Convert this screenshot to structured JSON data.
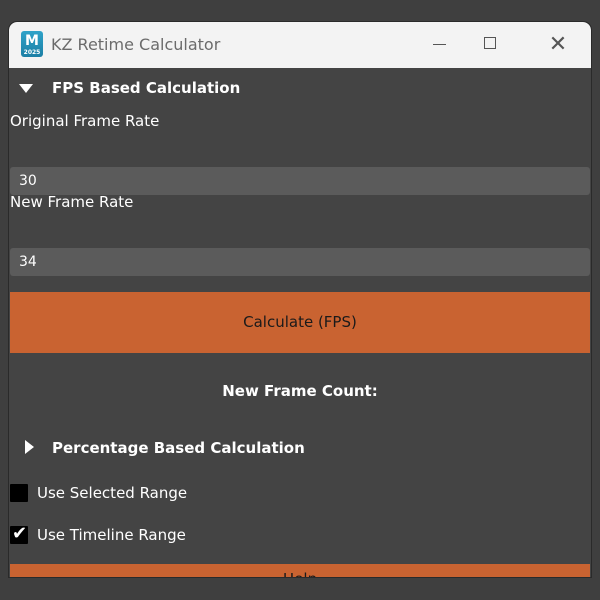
{
  "window": {
    "title": "KZ Retime Calculator",
    "app_icon_letter": "M",
    "app_icon_sub": "2025",
    "controls": {
      "close_glyph": "✕"
    }
  },
  "fps_section": {
    "title": "FPS Based Calculation",
    "expanded": true,
    "original_label": "Original Frame Rate",
    "original_value": "30",
    "new_label": "New Frame Rate",
    "new_value": "34",
    "calculate_label": "Calculate (FPS)",
    "result_label": "New Frame Count:"
  },
  "percentage_section": {
    "title": "Percentage Based Calculation",
    "expanded": false
  },
  "options": {
    "use_selected_range": {
      "label": "Use Selected Range",
      "checked": false
    },
    "use_timeline_range": {
      "label": "Use Timeline Range",
      "checked": true,
      "glyph": "✔"
    }
  },
  "help_label": "Help",
  "colors": {
    "accent": "#c96331",
    "panel": "#444444",
    "field": "#5b5b5b",
    "titlebar": "#f3f3f3"
  }
}
